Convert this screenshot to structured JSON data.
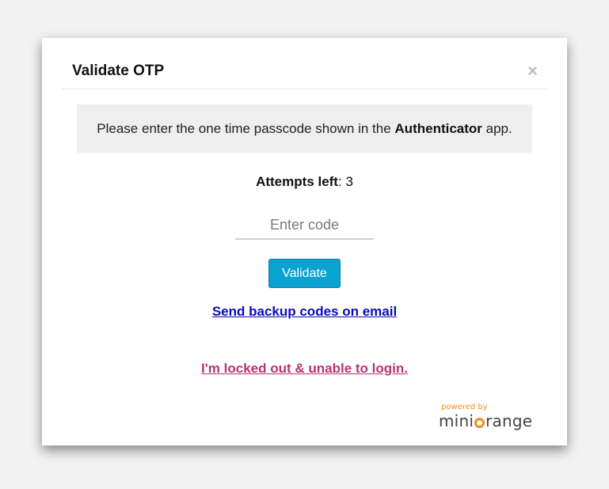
{
  "dialog": {
    "title": "Validate OTP",
    "close_symbol": "×"
  },
  "notice": {
    "text_before": "Please enter the one time passcode shown in the ",
    "app_name": "Authenticator",
    "text_after": " app."
  },
  "attempts": {
    "label": "Attempts left",
    "separator": ": ",
    "value": "3"
  },
  "code_input": {
    "placeholder": "Enter code",
    "value": ""
  },
  "buttons": {
    "validate_label": "Validate"
  },
  "links": {
    "backup_codes": "Send backup codes on email",
    "locked_out": "I'm locked out & unable to login."
  },
  "branding": {
    "powered_by": "powered by",
    "name_part1": "mini",
    "name_part2": "range",
    "icon": "orange-power-icon"
  },
  "colors": {
    "accent_button": "#0aa2d1",
    "backup_link": "#0a0ab8",
    "locked_link": "#b83270",
    "brand_orange": "#f38a1f"
  }
}
